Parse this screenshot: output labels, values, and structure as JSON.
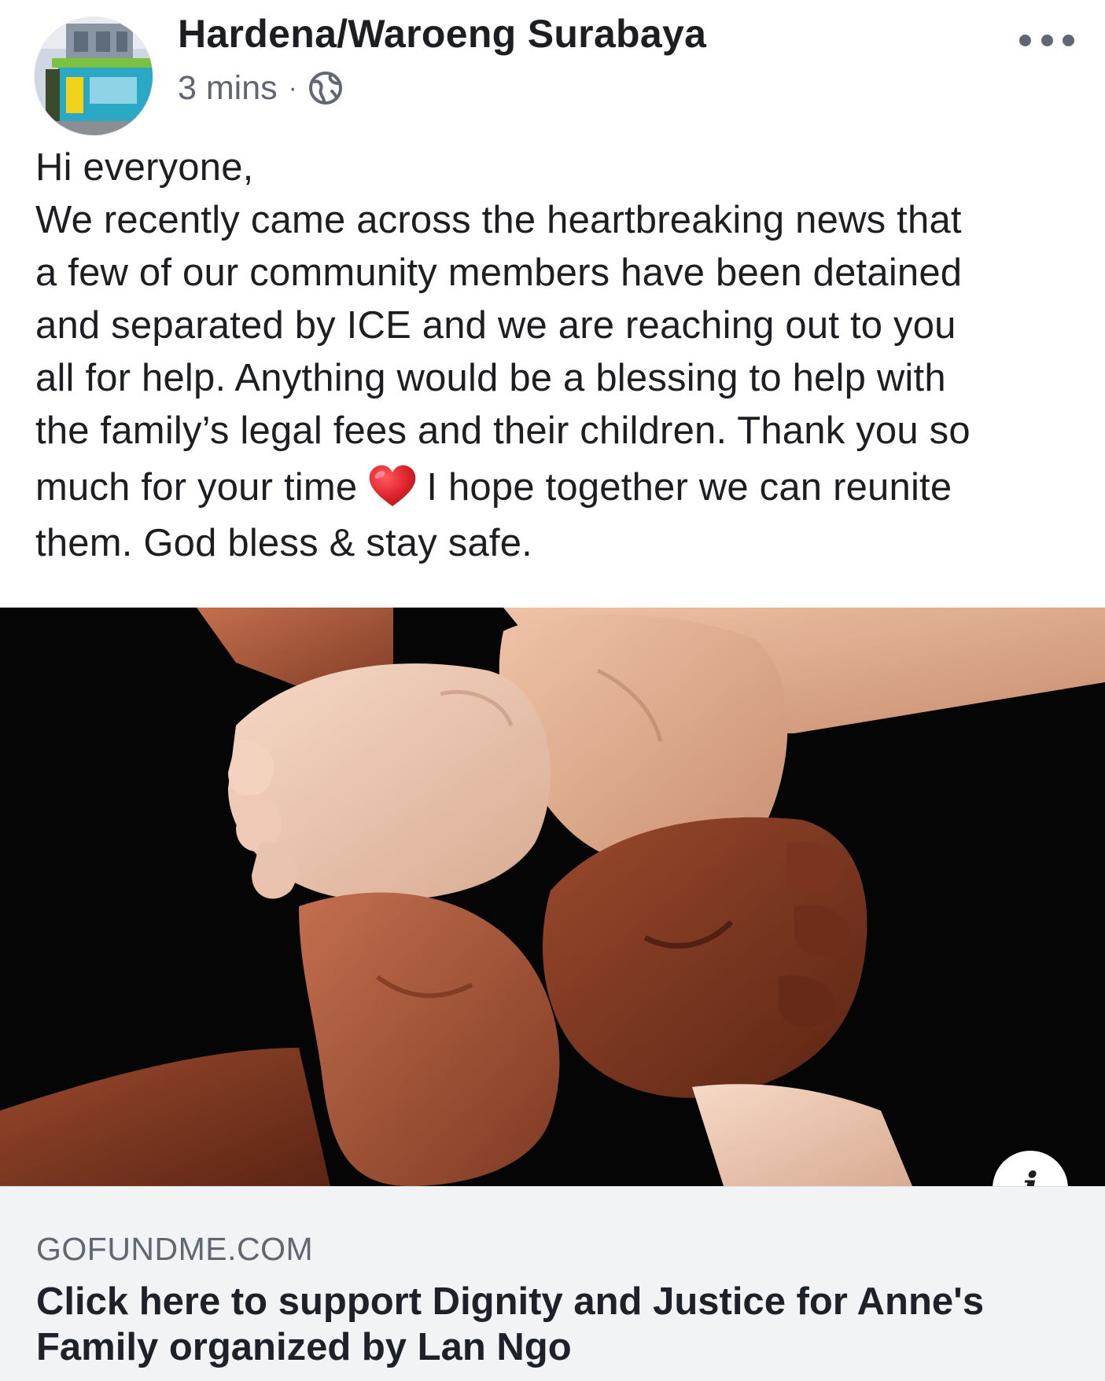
{
  "post": {
    "author": "Hardena/Waroeng Surabaya",
    "timestamp": "3 mins",
    "separator": "·",
    "privacy_icon": "globe-icon",
    "more_icon": "more-options-icon",
    "text_lines": [
      "Hi everyone,",
      "We recently came across the heartbreaking news that",
      "a few of our community members have been detained",
      "and separated by ICE and we are reaching out to you",
      "all for help. Anything would be a blessing to help with",
      "the family’s legal fees and their children. Thank you so"
    ],
    "text_line7_before": "much for your time",
    "text_line7_emoji": "red-heart-icon",
    "text_line7_after": "I hope together we can reunite",
    "text_line8": "them. God bless & stay safe."
  },
  "link_preview": {
    "image_icon": "linked-hands-photo",
    "info_icon_label": "i",
    "domain": "GOFUNDME.COM",
    "title_line1": "Click here to support Dignity and Justice for Anne's",
    "title_line2": "Family organized by Lan Ngo"
  },
  "colors": {
    "text_primary": "#1c1e21",
    "text_secondary": "#616770",
    "card_background": "#f2f3f5",
    "heart": "#e0262f"
  }
}
